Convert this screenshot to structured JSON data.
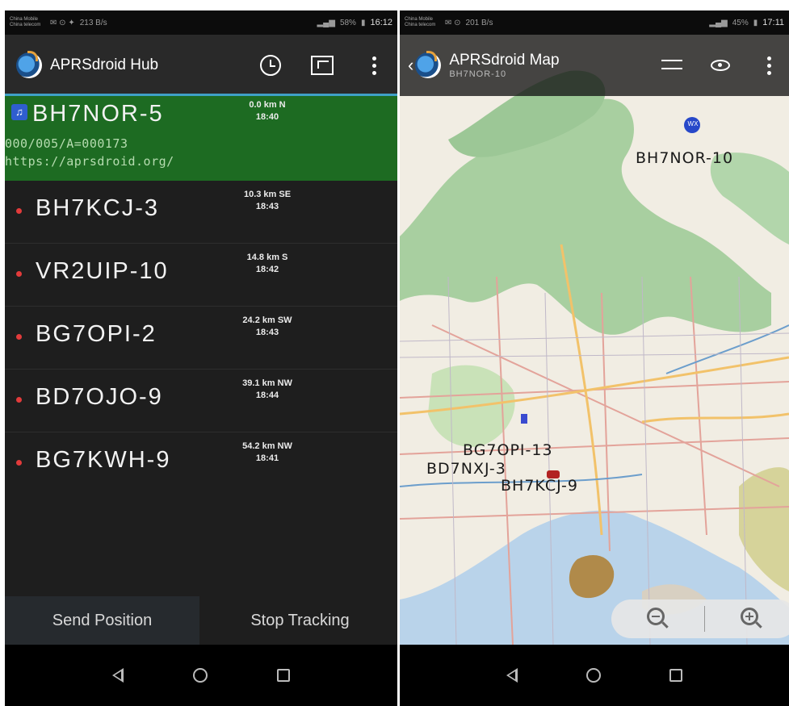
{
  "left": {
    "status": {
      "carrier": "China Mobile\nChina telecom",
      "speed": "213 B/s",
      "battery": "58%",
      "time": "16:12"
    },
    "actionbar": {
      "title": "APRSdroid Hub"
    },
    "stations": [
      {
        "callsign": "BH7NOR-5",
        "distance": "0.0 km N",
        "time": "18:40",
        "comment1": "000/005/A=000173",
        "comment2": "https://aprsdroid.org/"
      },
      {
        "callsign": "BH7KCJ-3",
        "distance": "10.3 km SE",
        "time": "18:43"
      },
      {
        "callsign": "VR2UIP-10",
        "distance": "14.8 km S",
        "time": "18:42"
      },
      {
        "callsign": "BG7OPI-2",
        "distance": "24.2 km SW",
        "time": "18:43"
      },
      {
        "callsign": "BD7OJO-9",
        "distance": "39.1 km NW",
        "time": "18:44"
      },
      {
        "callsign": "BG7KWH-9",
        "distance": "54.2 km NW",
        "time": "18:41"
      }
    ],
    "buttons": {
      "send": "Send Position",
      "stop": "Stop Tracking"
    }
  },
  "right": {
    "status": {
      "carrier": "China Mobile\nChina telecom",
      "speed": "201 B/s",
      "battery": "45%",
      "time": "17:11"
    },
    "actionbar": {
      "title": "APRSdroid Map",
      "subtitle": "BH7NOR-10"
    },
    "map_labels": {
      "a": "BH7NOR-10",
      "b": "BG7OPI-13",
      "c": "BD7NXJ-3",
      "d": "BH7KCJ-9"
    },
    "home_marker": "WX"
  },
  "colors": {
    "selected_row": "#1d6b22",
    "list_bg": "#1e1e1e",
    "accent": "#3fa0c6",
    "station_dot": "#e23b3b"
  }
}
